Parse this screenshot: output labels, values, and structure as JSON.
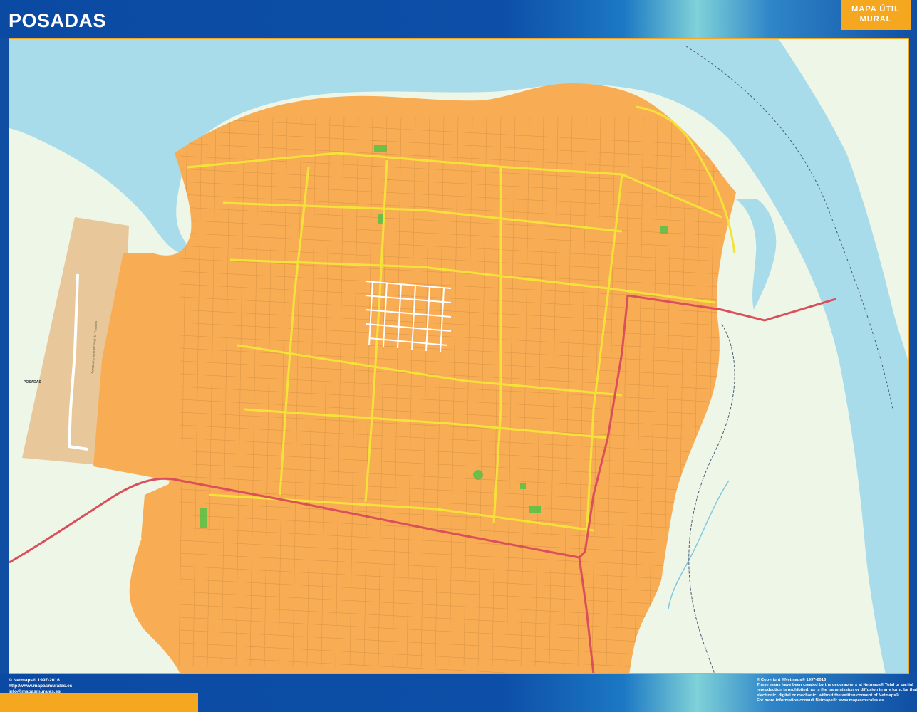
{
  "header": {
    "title": "POSADAS",
    "badge_line1": "MAPA ÚTIL",
    "badge_line2": "MURAL"
  },
  "map": {
    "place_labels": {
      "city_west": "POSADAS",
      "airport": "Aeropuerto Internacional de Posadas"
    },
    "colors": {
      "water": "#a8dcea",
      "land_other": "#eef6e8",
      "city": "#f8ad55",
      "airport": "#e8c89a",
      "primary_road": "#f4e23a",
      "highway": "#d9505a",
      "park": "#6cc04a",
      "border_line": "#4a5a7a"
    }
  },
  "footer": {
    "left_lines": [
      "© Netmaps® 1997-2016",
      "http://www.mapasmurales.es",
      "info@mapasmurales.es"
    ],
    "right_lines": [
      "© Copyright ©Netmaps® 1997-2016",
      "These maps have been created by the geographers at Netmaps® Total or partial",
      "reproduction is prohibited; as is the transmission or diffusion in any form, be that",
      "electronic, digital or mechanic; without the written consent of Netmaps®",
      "For more information consult Netmaps®: www.mapasmurales.es"
    ]
  }
}
